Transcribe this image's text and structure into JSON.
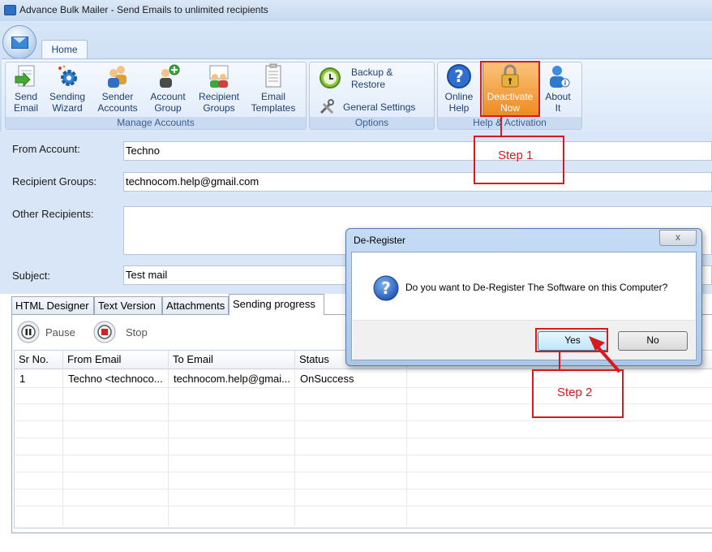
{
  "window": {
    "title": "Advance Bulk Mailer - Send Emails to unlimited recipients"
  },
  "ribbon": {
    "tab": "Home",
    "groups": {
      "manage_accounts": "Manage Accounts",
      "options": "Options",
      "help_activation": "Help & Activation"
    },
    "buttons": {
      "send_email": "Send\nEmail",
      "sending_wizard": "Sending\nWizard",
      "sender_accounts": "Sender\nAccounts",
      "account_group": "Account\nGroup",
      "recipient_groups": "Recipient\nGroups",
      "email_templates": "Email\nTemplates",
      "backup_restore": "Backup &\nRestore",
      "general_settings": "General Settings",
      "online_help": "Online\nHelp",
      "deactivate_now": "Deactivate\nNow",
      "about_it": "About\nIt"
    }
  },
  "form": {
    "from_account_label": "From Account:",
    "from_account_value": "Techno",
    "recipient_groups_label": "Recipient Groups:",
    "recipient_groups_value": "technocom.help@gmail.com",
    "other_recipients_label": "Other Recipients:",
    "other_recipients_value": "",
    "subject_label": "Subject:",
    "subject_value": "Test mail"
  },
  "tabs": [
    "HTML Designer",
    "Text Version",
    "Attachments",
    "Sending progress"
  ],
  "progress": {
    "pause_label": "Pause",
    "stop_label": "Stop",
    "columns": [
      "Sr No.",
      "From Email",
      "To Email",
      "Status"
    ],
    "rows": [
      {
        "sr": "1",
        "from": "Techno <technoco...",
        "to": "technocom.help@gmai...",
        "status": "OnSuccess"
      }
    ]
  },
  "dialog": {
    "title": "De-Register",
    "message": "Do you want to De-Register The Software on this Computer?",
    "yes": "Yes",
    "no": "No",
    "close": "x"
  },
  "annotations": {
    "step1": "Step 1",
    "step2": "Step 2"
  },
  "colors": {
    "annotation": "#d8191d",
    "deactivate_highlight": "#f39a2b"
  }
}
